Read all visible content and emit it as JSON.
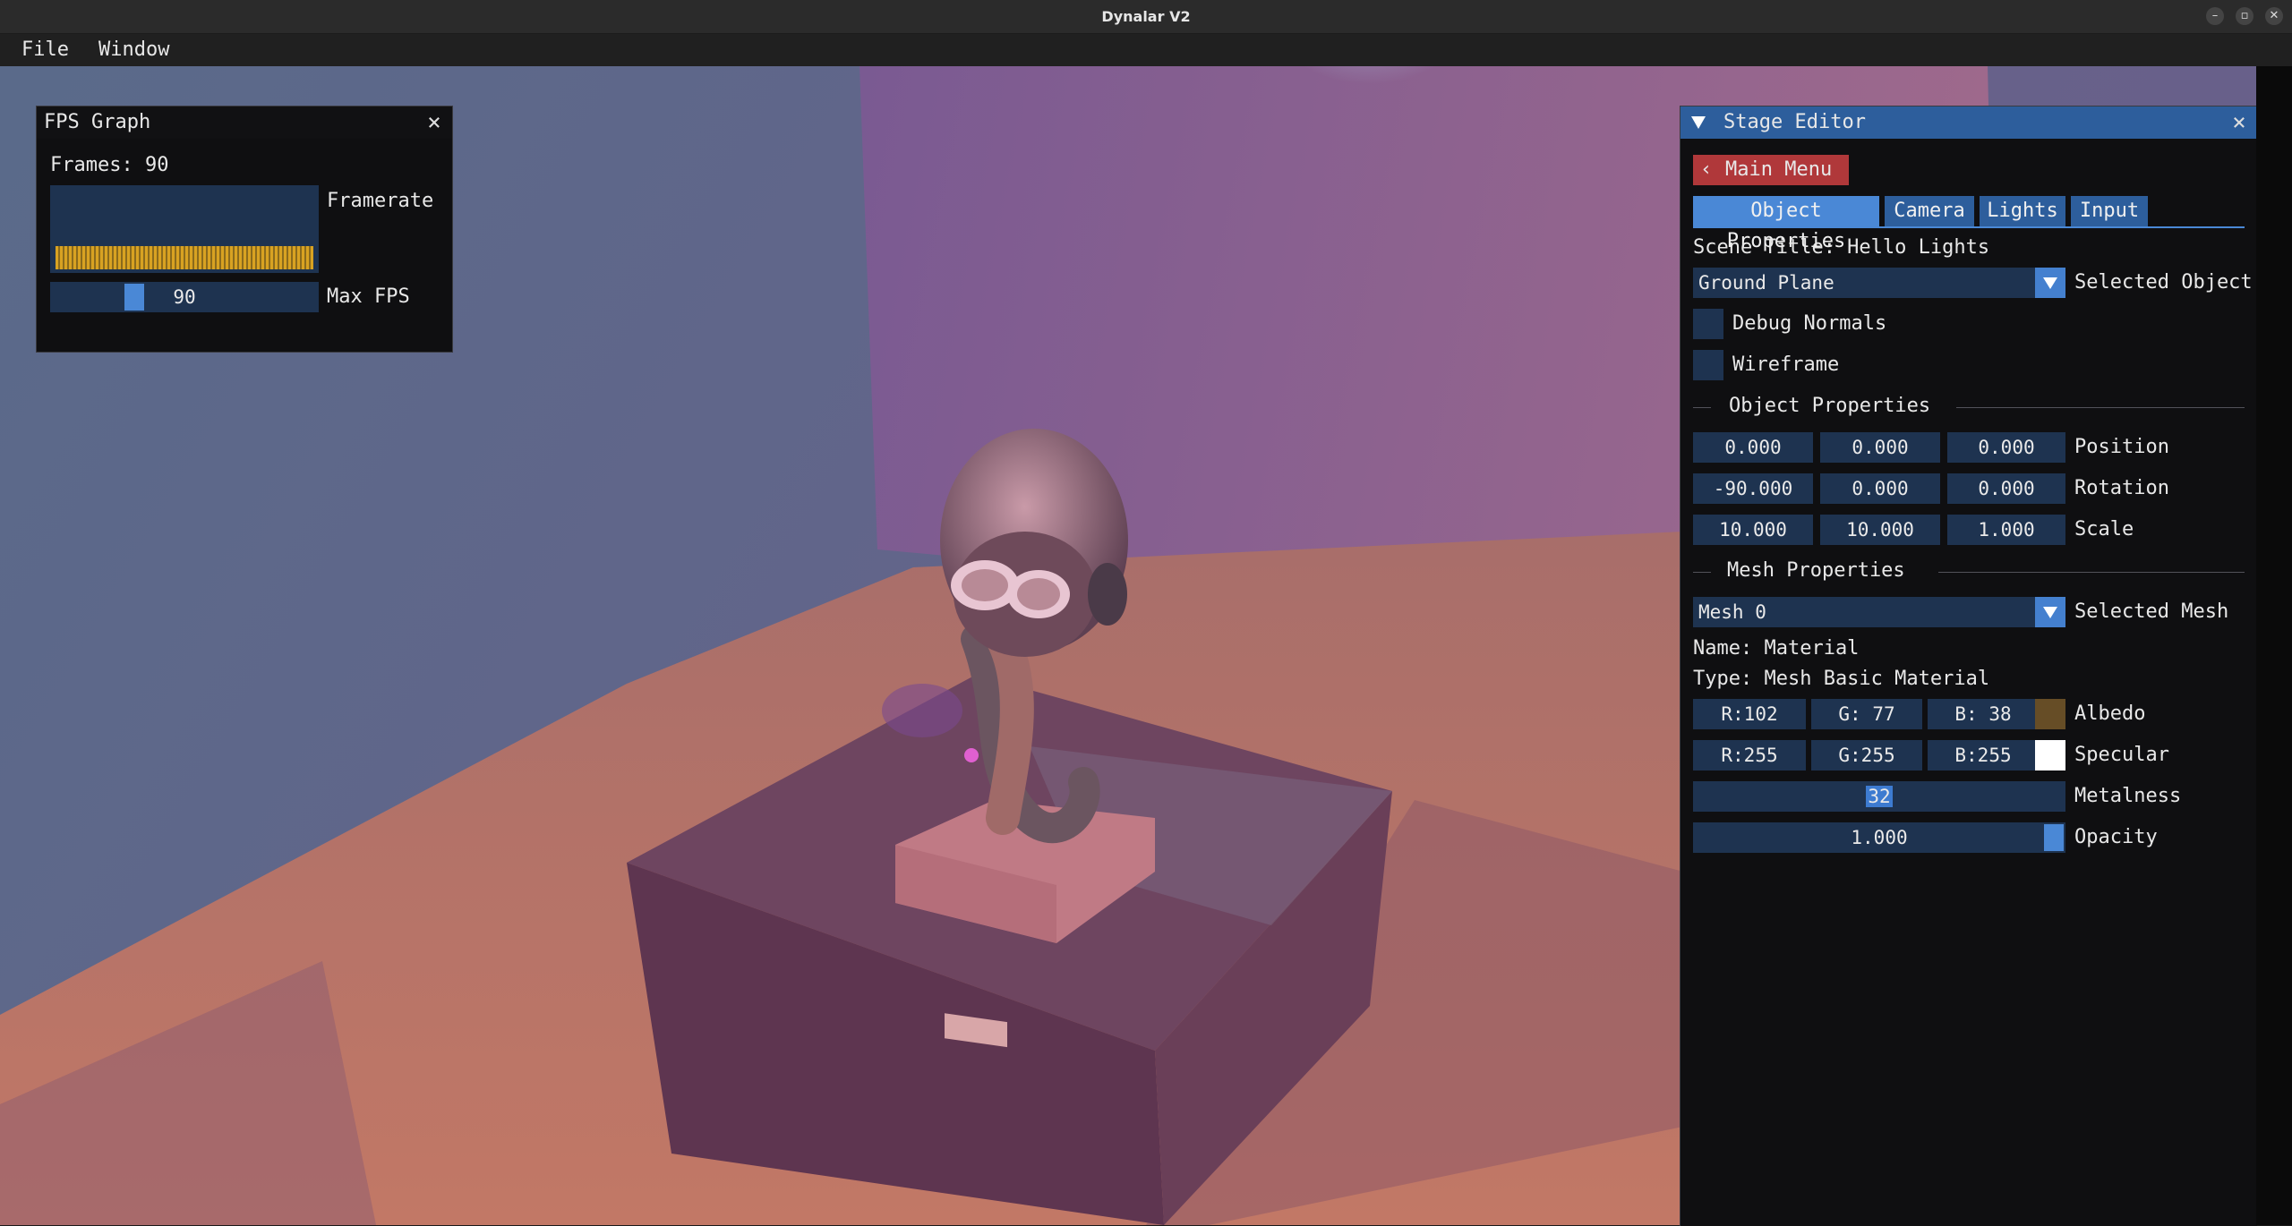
{
  "window": {
    "title": "Dynalar V2",
    "controls": [
      "–",
      "▫",
      "✕"
    ]
  },
  "menubar": {
    "items": [
      "File",
      "Window"
    ]
  },
  "fps_graph": {
    "title": "FPS Graph",
    "frames_label": "Frames: 90",
    "graph_label": "Framerate",
    "max_fps_value": "90",
    "max_fps_label": "Max FPS",
    "slider_fraction": 0.3
  },
  "stage_editor": {
    "title": "Stage Editor",
    "back_button": "Main Menu",
    "tabs": [
      "Object Properties",
      "Camera",
      "Lights",
      "Input"
    ],
    "scene_title": "Scene Title: Hello Lights",
    "selected_object": {
      "value": "Ground Plane",
      "label": "Selected Object"
    },
    "checkboxes": [
      {
        "label": "Debug Normals",
        "checked": false
      },
      {
        "label": "Wireframe",
        "checked": false
      }
    ],
    "object_properties": {
      "header": "Object Properties",
      "rows": [
        {
          "label": "Position",
          "values": [
            "0.000",
            "0.000",
            "0.000"
          ]
        },
        {
          "label": "Rotation",
          "values": [
            "-90.000",
            "0.000",
            "0.000"
          ]
        },
        {
          "label": "Scale",
          "values": [
            "10.000",
            "10.000",
            "1.000"
          ]
        }
      ]
    },
    "mesh_properties": {
      "header": "Mesh Properties",
      "selected_mesh": {
        "value": "Mesh 0",
        "label": "Selected Mesh"
      },
      "name_line": "Name: Material",
      "type_line": "Type: Mesh Basic Material",
      "albedo": {
        "r": "R:102",
        "g": "G: 77",
        "b": "B: 38",
        "label": "Albedo",
        "color": "#664d26"
      },
      "specular": {
        "r": "R:255",
        "g": "G:255",
        "b": "B:255",
        "label": "Specular",
        "color": "#ffffff"
      },
      "metalness": {
        "value": "32",
        "label": "Metalness"
      },
      "opacity": {
        "value": "1.000",
        "label": "Opacity",
        "fraction": 1.0
      }
    }
  },
  "colors": {
    "accent": "#4a88d6",
    "panel_bg": "#0f0f11",
    "field_bg": "#1e3350",
    "back_button": "#b0383a"
  }
}
